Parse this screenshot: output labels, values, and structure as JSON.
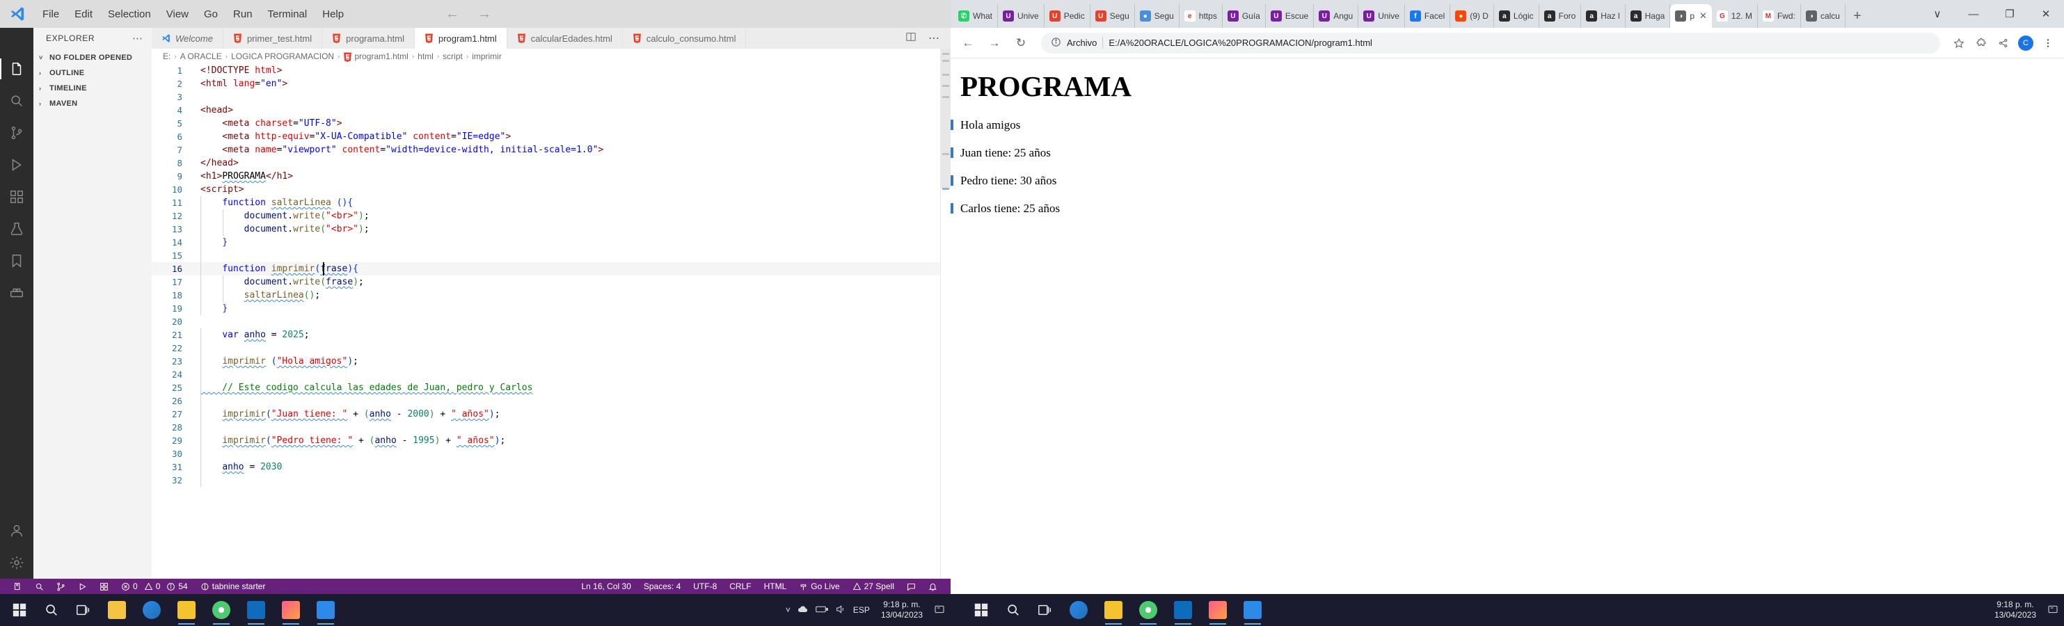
{
  "vscode": {
    "menu": [
      "File",
      "Edit",
      "Selection",
      "View",
      "Go",
      "Run",
      "Terminal",
      "Help"
    ],
    "sidebar_title": "EXPLORER",
    "sidebar_dots": "⋯",
    "sections": [
      {
        "label": "NO FOLDER OPENED",
        "chev": "˅"
      },
      {
        "label": "OUTLINE",
        "chev": "›"
      },
      {
        "label": "TIMELINE",
        "chev": "›"
      },
      {
        "label": "MAVEN",
        "chev": "›"
      }
    ],
    "tabs": [
      {
        "label": "Welcome",
        "icon": "vscode-icon",
        "active": false,
        "italic": true
      },
      {
        "label": "primer_test.html",
        "icon": "html5-icon",
        "active": false,
        "italic": false
      },
      {
        "label": "programa.html",
        "icon": "html5-icon",
        "active": false,
        "italic": false
      },
      {
        "label": "program1.html",
        "icon": "html5-icon",
        "active": true,
        "italic": false
      },
      {
        "label": "calcularEdades.html",
        "icon": "html5-icon",
        "active": false,
        "italic": false
      },
      {
        "label": "calculo_consumo.html",
        "icon": "html5-icon",
        "active": false,
        "italic": false
      }
    ],
    "breadcrumb": [
      "E:",
      "A ORACLE",
      "LOGICA PROGRAMACION",
      "program1.html",
      "html",
      "script",
      "imprimir"
    ],
    "code_lines": [
      {
        "n": 1,
        "tokens": [
          {
            "t": "<!DOCTYPE ",
            "c": "t-tag"
          },
          {
            "t": "html",
            "c": "t-attr"
          },
          {
            "t": ">",
            "c": "t-tag"
          }
        ]
      },
      {
        "n": 2,
        "tokens": [
          {
            "t": "<",
            "c": "t-tag"
          },
          {
            "t": "html",
            "c": "t-tag"
          },
          {
            "t": " ",
            "c": "t-plain"
          },
          {
            "t": "lang",
            "c": "t-attr"
          },
          {
            "t": "=",
            "c": "t-plain"
          },
          {
            "t": "\"en\"",
            "c": "t-str"
          },
          {
            "t": ">",
            "c": "t-tag"
          }
        ]
      },
      {
        "n": 3,
        "tokens": []
      },
      {
        "n": 4,
        "tokens": [
          {
            "t": "<",
            "c": "t-tag"
          },
          {
            "t": "head",
            "c": "t-tag"
          },
          {
            "t": ">",
            "c": "t-tag"
          }
        ]
      },
      {
        "n": 5,
        "tokens": [
          {
            "t": "    <",
            "c": "t-tag"
          },
          {
            "t": "meta",
            "c": "t-tag"
          },
          {
            "t": " ",
            "c": "t-plain"
          },
          {
            "t": "charset",
            "c": "t-attr"
          },
          {
            "t": "=",
            "c": "t-plain"
          },
          {
            "t": "\"UTF-8\"",
            "c": "t-str"
          },
          {
            "t": ">",
            "c": "t-tag"
          }
        ]
      },
      {
        "n": 6,
        "tokens": [
          {
            "t": "    <",
            "c": "t-tag"
          },
          {
            "t": "meta",
            "c": "t-tag"
          },
          {
            "t": " ",
            "c": "t-plain"
          },
          {
            "t": "http-equiv",
            "c": "t-attr"
          },
          {
            "t": "=",
            "c": "t-plain"
          },
          {
            "t": "\"X-UA-Compatible\"",
            "c": "t-str"
          },
          {
            "t": " ",
            "c": "t-plain"
          },
          {
            "t": "content",
            "c": "t-attr"
          },
          {
            "t": "=",
            "c": "t-plain"
          },
          {
            "t": "\"IE=edge\"",
            "c": "t-str"
          },
          {
            "t": ">",
            "c": "t-tag"
          }
        ]
      },
      {
        "n": 7,
        "tokens": [
          {
            "t": "    <",
            "c": "t-tag"
          },
          {
            "t": "meta",
            "c": "t-tag"
          },
          {
            "t": " ",
            "c": "t-plain"
          },
          {
            "t": "name",
            "c": "t-attr"
          },
          {
            "t": "=",
            "c": "t-plain"
          },
          {
            "t": "\"viewport\"",
            "c": "t-str"
          },
          {
            "t": " ",
            "c": "t-plain"
          },
          {
            "t": "content",
            "c": "t-attr"
          },
          {
            "t": "=",
            "c": "t-plain"
          },
          {
            "t": "\"width=device-width, initial-scale=1.0\"",
            "c": "t-str"
          },
          {
            "t": ">",
            "c": "t-tag"
          }
        ]
      },
      {
        "n": 8,
        "tokens": [
          {
            "t": "</",
            "c": "t-tag"
          },
          {
            "t": "head",
            "c": "t-tag"
          },
          {
            "t": ">",
            "c": "t-tag"
          }
        ]
      },
      {
        "n": 9,
        "tokens": [
          {
            "t": "<",
            "c": "t-tag"
          },
          {
            "t": "h1",
            "c": "t-tag"
          },
          {
            "t": ">",
            "c": "t-tag"
          },
          {
            "t": "PROGRAMA",
            "c": "t-plain squig"
          },
          {
            "t": "</",
            "c": "t-tag"
          },
          {
            "t": "h1",
            "c": "t-tag"
          },
          {
            "t": ">",
            "c": "t-tag"
          }
        ]
      },
      {
        "n": 10,
        "tokens": [
          {
            "t": "<",
            "c": "t-tag"
          },
          {
            "t": "script",
            "c": "t-tag"
          },
          {
            "t": ">",
            "c": "t-tag"
          }
        ]
      },
      {
        "n": 11,
        "tokens": [
          {
            "t": "    ",
            "c": "t-plain"
          },
          {
            "t": "function",
            "c": "t-kw"
          },
          {
            "t": " ",
            "c": "t-plain"
          },
          {
            "t": "saltarLinea",
            "c": "t-fn squig"
          },
          {
            "t": " ",
            "c": "t-plain"
          },
          {
            "t": "(){",
            "c": "t-brace1"
          }
        ]
      },
      {
        "n": 12,
        "tokens": [
          {
            "t": "        ",
            "c": "t-plain"
          },
          {
            "t": "document",
            "c": "t-var"
          },
          {
            "t": ".",
            "c": "t-plain"
          },
          {
            "t": "write",
            "c": "t-fn"
          },
          {
            "t": "(",
            "c": "t-brace2"
          },
          {
            "t": "\"<br>\"",
            "c": "t-attr"
          },
          {
            "t": ")",
            "c": "t-brace2"
          },
          {
            "t": ";",
            "c": "t-plain"
          }
        ]
      },
      {
        "n": 13,
        "tokens": [
          {
            "t": "        ",
            "c": "t-plain"
          },
          {
            "t": "document",
            "c": "t-var"
          },
          {
            "t": ".",
            "c": "t-plain"
          },
          {
            "t": "write",
            "c": "t-fn"
          },
          {
            "t": "(",
            "c": "t-brace2"
          },
          {
            "t": "\"<br>\"",
            "c": "t-attr"
          },
          {
            "t": ")",
            "c": "t-brace2"
          },
          {
            "t": ";",
            "c": "t-plain"
          }
        ]
      },
      {
        "n": 14,
        "tokens": [
          {
            "t": "    ",
            "c": "t-plain"
          },
          {
            "t": "}",
            "c": "t-brace1"
          }
        ]
      },
      {
        "n": 15,
        "tokens": []
      },
      {
        "n": 16,
        "tokens": [
          {
            "t": "    ",
            "c": "t-plain"
          },
          {
            "t": "function",
            "c": "t-kw"
          },
          {
            "t": " ",
            "c": "t-plain"
          },
          {
            "t": "imprimir",
            "c": "t-fn squig"
          },
          {
            "t": "(",
            "c": "t-brace1"
          },
          {
            "t": "frase",
            "c": "t-var squig"
          },
          {
            "t": "){",
            "c": "t-brace1"
          }
        ],
        "hl": true
      },
      {
        "n": 17,
        "tokens": [
          {
            "t": "        ",
            "c": "t-plain"
          },
          {
            "t": "document",
            "c": "t-var"
          },
          {
            "t": ".",
            "c": "t-plain"
          },
          {
            "t": "write",
            "c": "t-fn"
          },
          {
            "t": "(",
            "c": "t-brace2"
          },
          {
            "t": "frase",
            "c": "t-var squig"
          },
          {
            "t": ")",
            "c": "t-brace2"
          },
          {
            "t": ";",
            "c": "t-plain"
          }
        ]
      },
      {
        "n": 18,
        "tokens": [
          {
            "t": "        ",
            "c": "t-plain"
          },
          {
            "t": "saltarLinea",
            "c": "t-fn squig"
          },
          {
            "t": "()",
            "c": "t-brace2"
          },
          {
            "t": ";",
            "c": "t-plain"
          }
        ]
      },
      {
        "n": 19,
        "tokens": [
          {
            "t": "    ",
            "c": "t-plain"
          },
          {
            "t": "}",
            "c": "t-brace1"
          }
        ]
      },
      {
        "n": 20,
        "tokens": []
      },
      {
        "n": 21,
        "tokens": [
          {
            "t": "    ",
            "c": "t-plain"
          },
          {
            "t": "var",
            "c": "t-kw"
          },
          {
            "t": " ",
            "c": "t-plain"
          },
          {
            "t": "anho",
            "c": "t-var squig"
          },
          {
            "t": " = ",
            "c": "t-plain"
          },
          {
            "t": "2025",
            "c": "t-num"
          },
          {
            "t": ";",
            "c": "t-plain"
          }
        ]
      },
      {
        "n": 22,
        "tokens": []
      },
      {
        "n": 23,
        "tokens": [
          {
            "t": "    ",
            "c": "t-plain"
          },
          {
            "t": "imprimir",
            "c": "t-fn squig"
          },
          {
            "t": " (",
            "c": "t-brace1"
          },
          {
            "t": "\"Hola amigos\"",
            "c": "t-attr squig"
          },
          {
            "t": ")",
            "c": "t-brace1"
          },
          {
            "t": ";",
            "c": "t-plain"
          }
        ]
      },
      {
        "n": 24,
        "tokens": []
      },
      {
        "n": 25,
        "tokens": [
          {
            "t": "    // Este codigo calcula las edades de Juan, pedro y Carlos",
            "c": "t-comment squig"
          }
        ]
      },
      {
        "n": 26,
        "tokens": []
      },
      {
        "n": 27,
        "tokens": [
          {
            "t": "    ",
            "c": "t-plain"
          },
          {
            "t": "imprimir",
            "c": "t-fn squig"
          },
          {
            "t": "(",
            "c": "t-brace1"
          },
          {
            "t": "\"Juan tiene: \"",
            "c": "t-attr squig"
          },
          {
            "t": " + ",
            "c": "t-plain"
          },
          {
            "t": "(",
            "c": "t-brace2"
          },
          {
            "t": "anho",
            "c": "t-var squig"
          },
          {
            "t": " - ",
            "c": "t-plain"
          },
          {
            "t": "2000",
            "c": "t-num"
          },
          {
            "t": ")",
            "c": "t-brace2"
          },
          {
            "t": " + ",
            "c": "t-plain"
          },
          {
            "t": "\" años\"",
            "c": "t-attr squig"
          },
          {
            "t": ")",
            "c": "t-brace1"
          },
          {
            "t": ";",
            "c": "t-plain"
          }
        ]
      },
      {
        "n": 28,
        "tokens": []
      },
      {
        "n": 29,
        "tokens": [
          {
            "t": "    ",
            "c": "t-plain"
          },
          {
            "t": "imprimir",
            "c": "t-fn squig"
          },
          {
            "t": "(",
            "c": "t-brace1"
          },
          {
            "t": "\"Pedro tiene: \"",
            "c": "t-attr squig"
          },
          {
            "t": " + ",
            "c": "t-plain"
          },
          {
            "t": "(",
            "c": "t-brace2"
          },
          {
            "t": "anho",
            "c": "t-var squig"
          },
          {
            "t": " - ",
            "c": "t-plain"
          },
          {
            "t": "1995",
            "c": "t-num"
          },
          {
            "t": ")",
            "c": "t-brace2"
          },
          {
            "t": " + ",
            "c": "t-plain"
          },
          {
            "t": "\" años\"",
            "c": "t-attr squig"
          },
          {
            "t": ")",
            "c": "t-brace1"
          },
          {
            "t": ";",
            "c": "t-plain"
          }
        ]
      },
      {
        "n": 30,
        "tokens": []
      },
      {
        "n": 31,
        "tokens": [
          {
            "t": "    ",
            "c": "t-plain"
          },
          {
            "t": "anho",
            "c": "t-var squig"
          },
          {
            "t": " = ",
            "c": "t-plain"
          },
          {
            "t": "2030",
            "c": "t-num"
          }
        ]
      },
      {
        "n": 32,
        "tokens": []
      }
    ],
    "status_left": [
      {
        "label": "0",
        "icon": "error-icon"
      },
      {
        "label": "0",
        "icon": "warning-icon"
      },
      {
        "label": "54",
        "icon": "info-icon"
      }
    ],
    "status_tabnine": "tabnine starter",
    "status_right": [
      {
        "label": "Ln 16, Col 30",
        "icon": ""
      },
      {
        "label": "Spaces: 4",
        "icon": ""
      },
      {
        "label": "UTF-8",
        "icon": ""
      },
      {
        "label": "CRLF",
        "icon": ""
      },
      {
        "label": "HTML",
        "icon": ""
      },
      {
        "label": "Go Live",
        "icon": "broadcast-icon"
      },
      {
        "label": "27 Spell",
        "icon": "warning-icon"
      }
    ],
    "status_bar_color": "#68217a"
  },
  "browser": {
    "tabs": [
      {
        "label": "What",
        "fav": "whatsapp-icon",
        "color": "#25D366",
        "glyph": "✆",
        "active": false
      },
      {
        "label": "Unive",
        "fav": "u-icon",
        "color": "#7B1FA2",
        "glyph": "U",
        "active": false
      },
      {
        "label": "Pedic",
        "fav": "square-icon",
        "color": "#E8412B",
        "glyph": "U",
        "active": false
      },
      {
        "label": "Segu",
        "fav": "square-icon",
        "color": "#E8412B",
        "glyph": "U",
        "active": false
      },
      {
        "label": "Segu",
        "fav": "globe-icon",
        "color": "#4a90d9",
        "glyph": "●",
        "active": false
      },
      {
        "label": "https",
        "fav": "e-icon",
        "color": "#ffffff",
        "glyph": "e",
        "active": false
      },
      {
        "label": "Guía",
        "fav": "u-icon",
        "color": "#7B1FA2",
        "glyph": "U",
        "active": false
      },
      {
        "label": "Escue",
        "fav": "u-icon",
        "color": "#7B1FA2",
        "glyph": "U",
        "active": false
      },
      {
        "label": "Angu",
        "fav": "u-icon",
        "color": "#7B1FA2",
        "glyph": "U",
        "active": false
      },
      {
        "label": "Unive",
        "fav": "u-icon",
        "color": "#7B1FA2",
        "glyph": "U",
        "active": false
      },
      {
        "label": "Facel",
        "fav": "facebook-icon",
        "color": "#1877F2",
        "glyph": "f",
        "active": false
      },
      {
        "label": "(9) D",
        "fav": "reddit-icon",
        "color": "#FF4500",
        "glyph": "●",
        "active": false
      },
      {
        "label": "Lógic",
        "fav": "a-icon",
        "color": "#2b2b2b",
        "glyph": "a",
        "active": false
      },
      {
        "label": "Foro",
        "fav": "a-icon",
        "color": "#2b2b2b",
        "glyph": "a",
        "active": false
      },
      {
        "label": "Haz l",
        "fav": "a-icon",
        "color": "#2b2b2b",
        "glyph": "a",
        "active": false
      },
      {
        "label": "Haga",
        "fav": "a-icon",
        "color": "#2b2b2b",
        "glyph": "a",
        "active": false
      },
      {
        "label": "p",
        "fav": "globe-icon",
        "color": "#5f6368",
        "glyph": "◑",
        "active": true
      },
      {
        "label": "12. M",
        "fav": "google-icon",
        "color": "#ffffff",
        "glyph": "G",
        "active": false
      },
      {
        "label": "Fwd:",
        "fav": "gmail-icon",
        "color": "#ffffff",
        "glyph": "M",
        "active": false
      },
      {
        "label": "calcu",
        "fav": "globe-icon",
        "color": "#5f6368",
        "glyph": "◑",
        "active": false
      }
    ],
    "new_tab_label": "+",
    "window_buttons": [
      "∨",
      "—",
      "❐",
      "✕"
    ],
    "nav": {
      "back": "←",
      "forward": "→",
      "reload": "↻"
    },
    "omnibox": {
      "scheme_label": "Archivo",
      "url": "E:/A%20ORACLE/LOGICA%20PROGRAMACION/program1.html",
      "info_icon": "info-circle-icon"
    },
    "toolbar_icons": [
      "bookmark-star-icon",
      "extensions-puzzle-icon",
      "share-icon",
      "chrome-profile-icon",
      "menu-dots-icon"
    ],
    "avatar_initial": "C",
    "page": {
      "heading": "PROGRAMA",
      "paragraphs": [
        "Hola amigos",
        "Juan tiene: 25 años",
        "Pedro tiene: 30 años",
        "Carlos tiene: 25 años"
      ]
    }
  },
  "taskbar": {
    "search_placeholder": "",
    "apps": [
      {
        "name": "file-explorer",
        "color": "#f6c445"
      },
      {
        "name": "edge-browser",
        "color": "#2d8ae8"
      },
      {
        "name": "folder",
        "color": "#f4c430"
      },
      {
        "name": "chrome",
        "color": "#4ecb71"
      },
      {
        "name": "outlook",
        "color": "#0f6cbd"
      },
      {
        "name": "intellij",
        "color": "#ff5b8a"
      },
      {
        "name": "vscode",
        "color": "#2d8ae8"
      }
    ],
    "lang": "ESP",
    "clock_time": "9:18 p. m.",
    "clock_date": "13/04/2023"
  }
}
